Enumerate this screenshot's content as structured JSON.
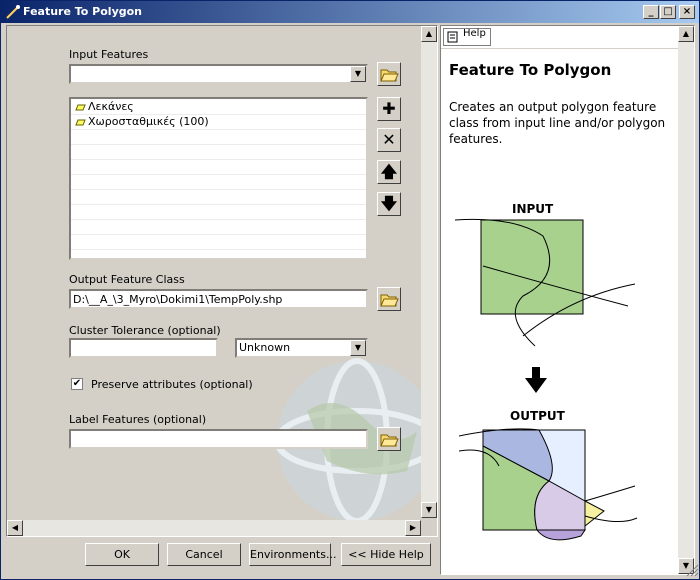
{
  "window": {
    "title": "Feature To Polygon"
  },
  "form": {
    "input_features_label": "Input Features",
    "input_features_value": "",
    "input_list": [
      "Λεκάνες",
      "Χωροσταθμικές (100)"
    ],
    "output_label": "Output Feature Class",
    "output_value": "D:\\__A_\\3_Myro\\Dokimi1\\TempPoly.shp",
    "cluster_label": "Cluster Tolerance (optional)",
    "cluster_value": "",
    "cluster_units": "Unknown",
    "preserve_label": "Preserve attributes (optional)",
    "preserve_checked": true,
    "label_features_label": "Label Features (optional)",
    "label_features_value": ""
  },
  "buttons": {
    "ok": "OK",
    "cancel": "Cancel",
    "environments": "Environments...",
    "hide_help": "<< Hide Help"
  },
  "help": {
    "tab_label": "Help",
    "title": "Feature To Polygon",
    "description": "Creates an output polygon feature class from input line and/or polygon features.",
    "input_caption": "INPUT",
    "output_caption": "OUTPUT"
  },
  "colors": {
    "title_start": "#0a246a",
    "title_end": "#a6caf0",
    "poly_green": "#a9d18e",
    "poly_blue": "#aab7e0",
    "poly_lilac": "#d7cbe7",
    "poly_yellow": "#f7f0a0"
  }
}
